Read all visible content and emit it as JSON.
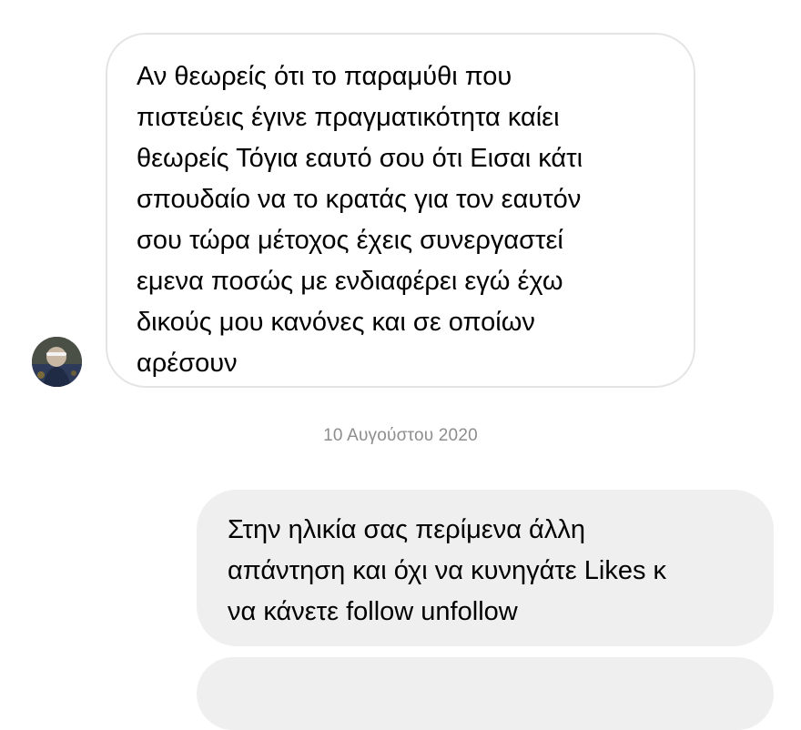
{
  "thread": {
    "incoming_message": {
      "lines": [
        "Αν θεωρείς ότι το παραμύθι που",
        "πιστεύεις έγινε πραγματικότητα καίει",
        "θεωρείς Τόγια εαυτό σου ότι Εισαι κάτι",
        "σπουδαίο να το κρατάς για τον εαυτόν",
        "σου τώρα μέτοχος έχεις συνεργαστεί",
        "εμενα ποσώς με ενδιαφέρει εγώ έχω",
        "δικούς μου κανόνες και σε οποίων",
        "αρέσουν"
      ]
    },
    "date_divider": "10 Αυγούστου 2020",
    "outgoing_message": {
      "lines": [
        "Στην ηλικία σας περίμενα άλλη",
        "απάντηση και όχι να κυνηγάτε Likes κ",
        "να κάνετε follow unfollow"
      ]
    }
  },
  "colors": {
    "incoming_bubble_border": "#e4e4e6",
    "outgoing_bubble_fill": "#efefef",
    "date_text": "#8e8e8e"
  }
}
